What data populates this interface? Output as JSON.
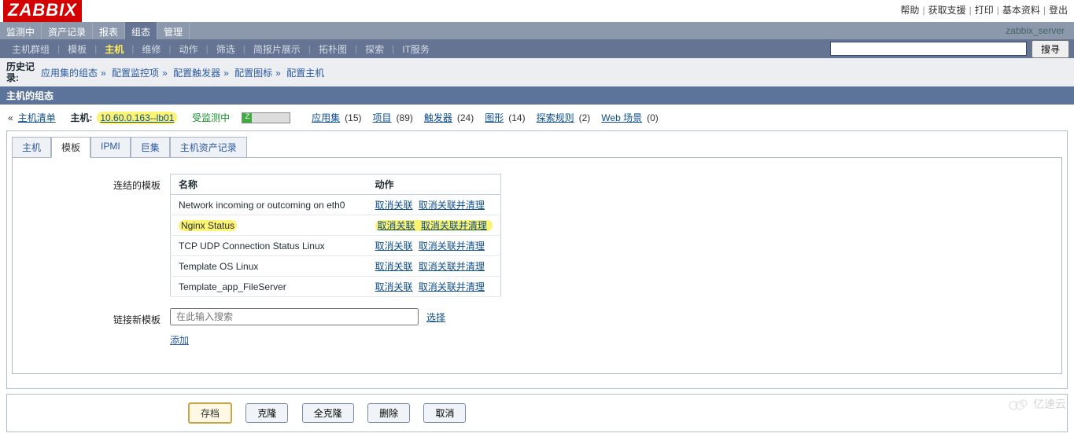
{
  "logo": "ZABBIX",
  "toplinks": [
    "帮助",
    "获取支援",
    "打印",
    "基本资料",
    "登出"
  ],
  "nav1": {
    "items": [
      "监测中",
      "资产记录",
      "报表",
      "组态",
      "管理"
    ],
    "activeIndex": 3
  },
  "servername": "zabbix_server",
  "nav2": {
    "items": [
      "主机群组",
      "模板",
      "主机",
      "维修",
      "动作",
      "筛选",
      "简报片展示",
      "拓朴图",
      "探索",
      "IT服务"
    ],
    "activeIndex": 2,
    "searchBtn": "搜寻"
  },
  "history": {
    "label": "历史记录:",
    "crumbs": [
      "应用集的组态",
      "配置监控项",
      "配置触发器",
      "配置图标",
      "配置主机"
    ]
  },
  "sectionTitle": "主机的组态",
  "hostrow": {
    "back": "主机清单",
    "hostLabel": "主机:",
    "hostValue": "10.60.0.163--lb01",
    "monitored": "受监测中",
    "counts": [
      {
        "label": "应用集",
        "n": "(15)"
      },
      {
        "label": "项目",
        "n": "(89)"
      },
      {
        "label": "触发器",
        "n": "(24)"
      },
      {
        "label": "图形",
        "n": "(14)"
      },
      {
        "label": "探索规则",
        "n": "(2)"
      },
      {
        "label": "Web 场景",
        "n": "(0)"
      }
    ]
  },
  "tabs": [
    "主机",
    "模板",
    "IPMI",
    "巨集",
    "主机资产记录"
  ],
  "activeTab": 1,
  "form": {
    "linkedLabel": "连结的模板",
    "thName": "名称",
    "thAction": "动作",
    "unlink": "取消关联",
    "unlinkClear": "取消关联并清理",
    "templates": [
      "Network incoming or outcoming on eth0",
      "Nginx Status",
      "TCP UDP Connection Status Linux",
      "Template OS Linux",
      "Template_app_FileServer"
    ],
    "hlIndex": 1,
    "newLabel": "链接新模板",
    "placeholder": "在此输入搜索",
    "select": "选择",
    "add": "添加"
  },
  "actions": {
    "save": "存档",
    "clone": "克隆",
    "fullClone": "全克隆",
    "delete": "删除",
    "cancel": "取消"
  },
  "watermark": "亿速云"
}
